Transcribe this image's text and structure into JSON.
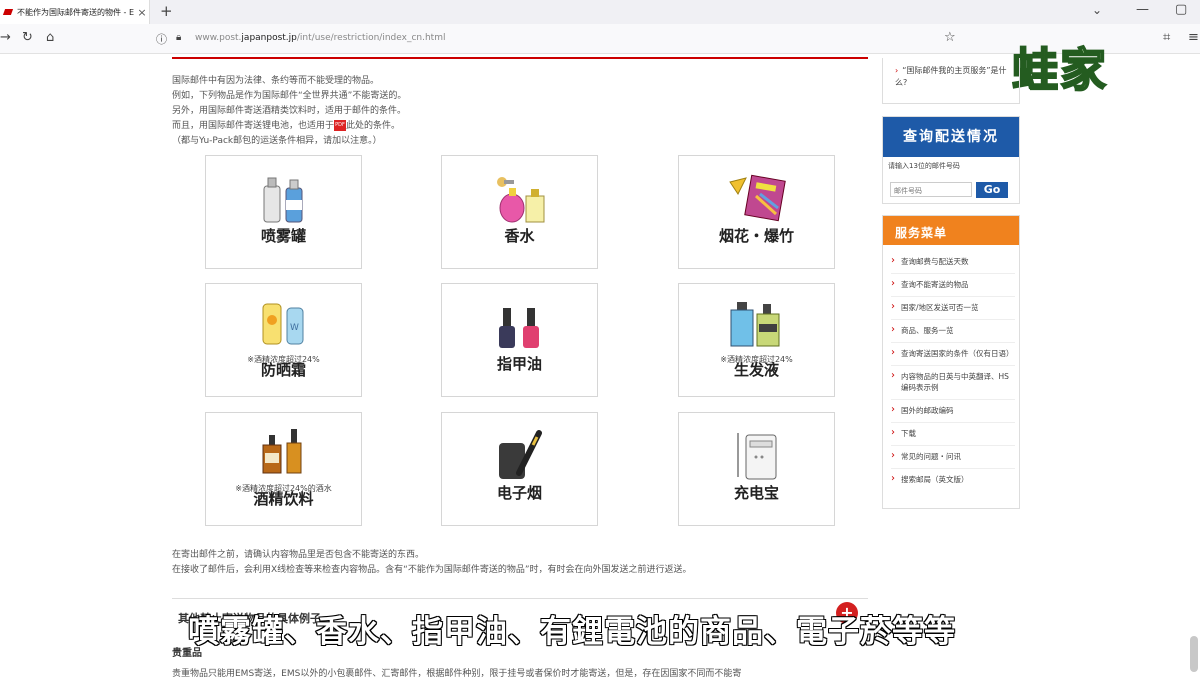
{
  "browser": {
    "tab_title": "不能作为国际邮件寄送的物件 - E",
    "tab_close": "×",
    "new_tab": "+",
    "tab_menu": "⌄",
    "min": "—",
    "max": "▢",
    "url_prefix": "www.post.",
    "url_domain": "japanpost.jp",
    "url_suffix": "/int/use/restriction/index_cn.html"
  },
  "watermark": "蛙家",
  "intro_lines": [
    "国际邮件中有因为法律、条约等而不能受理的物品。",
    "例如，下列物品是作为国际邮件“全世界共通”不能寄送的。",
    "另外，用国际邮件寄送酒精类饮料时，适用于邮件的条件。",
    "而且，用国际邮件寄送锂电池，也适用于",
    "此处的条件。",
    "（都与Yu-Pack邮包的运送条件相异，请加以注意。）"
  ],
  "pdf_icon_text": "PDF",
  "items": [
    {
      "name": "喷雾罐",
      "note": ""
    },
    {
      "name": "香水",
      "note": ""
    },
    {
      "name": "烟花・爆竹",
      "note": ""
    },
    {
      "name": "防晒霜",
      "note": "※酒精浓度超过24%"
    },
    {
      "name": "指甲油",
      "note": ""
    },
    {
      "name": "生发液",
      "note": "※酒精浓度超过24%"
    },
    {
      "name": "酒精饮料",
      "note": "※酒精浓度超过24%的酒水"
    },
    {
      "name": "电子烟",
      "note": ""
    },
    {
      "name": "充电宝",
      "note": ""
    }
  ],
  "footer_lines": [
    "在寄出邮件之前，请确认内容物品里是否包含不能寄送的东西。",
    "在接收了邮件后，会利用X线检查等来检查内容物品。含有“不能作为国际邮件寄送的物品”时，有时会在向外国发送之前进行返送。"
  ],
  "section": {
    "title": "其他禁止寄送物品的具体例子",
    "plus": "+",
    "sub": "贵重品",
    "body": "贵重物品只能用EMS寄送，EMS以外的小包裹邮件、汇寄邮件，根据邮件种别，限于挂号或者保价时才能寄送，但是，存在因国家不同而不能寄"
  },
  "subtitle": "噴霧罐、香水、指甲油、有鋰電池的商品、電子菸等等",
  "sidebar": {
    "faq_arrow": "›",
    "faq_text": "“国际邮件我的主页服务”是什么?",
    "track_title": "查询配送情况",
    "track_label": "请输入13位的邮件号码",
    "track_placeholder": "邮件号码",
    "go_label": "Go",
    "menu_title": "服务菜单",
    "menu_items": [
      "查询邮费与配送天数",
      "查询不能寄送的物品",
      "国家/地区发送可否一览",
      "商品、服务一览",
      "查询寄送国家的条件（仅有日语）",
      "内容物品的日英与中英翻译、HS编码表示例",
      "国外的邮政编码",
      "下载",
      "常见的问题・问讯",
      "搜索邮局（英文版）"
    ]
  },
  "colors": {
    "brand_red": "#cc0000",
    "track_blue": "#1e5aa8",
    "menu_orange": "#f0821e"
  }
}
